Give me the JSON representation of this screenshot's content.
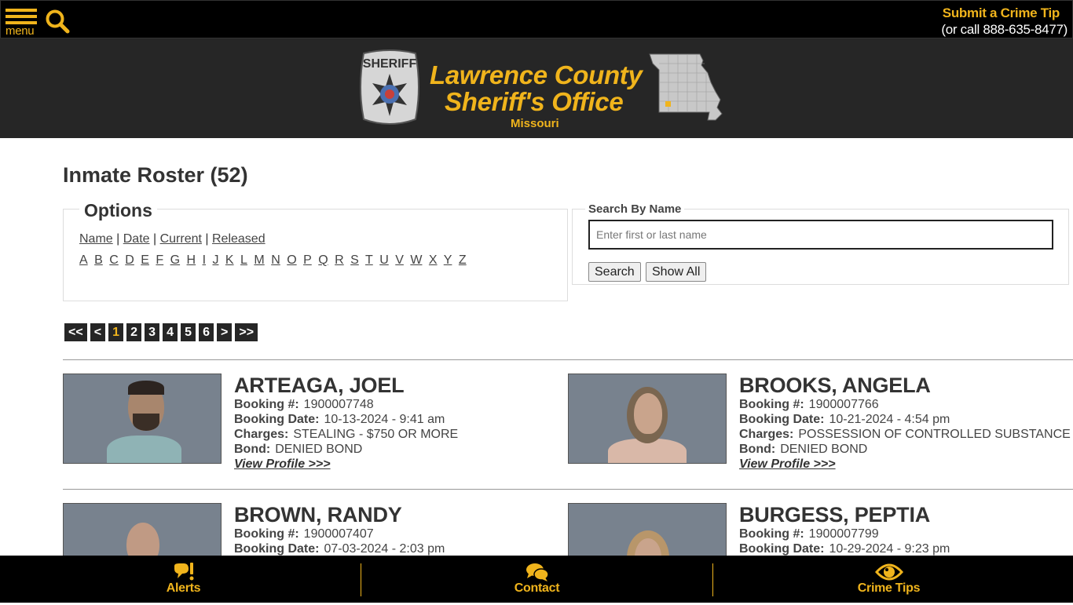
{
  "topbar": {
    "menu_label": "menu",
    "crime_tip_label": "Submit a Crime Tip",
    "crime_tip_phone": "(or call 888-635-8477)"
  },
  "banner": {
    "title_line1": "Lawrence County",
    "title_line2": "Sheriff's Office",
    "state": "Missouri",
    "badge_text": "SHERIFF"
  },
  "page": {
    "title": "Inmate Roster (52)"
  },
  "options": {
    "legend": "Options",
    "sort_links": [
      "Name",
      "Date",
      "Current",
      "Released"
    ],
    "letters": [
      "A",
      "B",
      "C",
      "D",
      "E",
      "F",
      "G",
      "H",
      "I",
      "J",
      "K",
      "L",
      "M",
      "N",
      "O",
      "P",
      "Q",
      "R",
      "S",
      "T",
      "U",
      "V",
      "W",
      "X",
      "Y",
      "Z"
    ]
  },
  "search": {
    "legend": "Search By Name",
    "placeholder": "Enter first or last name",
    "value": "",
    "search_button": "Search",
    "show_all_button": "Show All"
  },
  "pagination": {
    "first": "<<",
    "prev": "<",
    "pages": [
      "1",
      "2",
      "3",
      "4",
      "5",
      "6"
    ],
    "current": "1",
    "next": ">",
    "last": ">>"
  },
  "labels": {
    "booking_num": "Booking #:",
    "booking_date": "Booking Date:",
    "charges": "Charges:",
    "bond": "Bond:",
    "view_profile": "View Profile >>>"
  },
  "inmates": [
    {
      "name": "ARTEAGA, JOEL",
      "booking_num": "1900007748",
      "booking_date": "10-13-2024 - 9:41 am",
      "charges": "STEALING - $750 OR MORE",
      "bond": "DENIED BOND"
    },
    {
      "name": "BROOKS, ANGELA",
      "booking_num": "1900007766",
      "booking_date": "10-21-2024 - 4:54 pm",
      "charges": "POSSESSION OF CONTROLLED SUBSTANCE",
      "bond": "DENIED BOND"
    },
    {
      "name": "BROWN, RANDY",
      "booking_num": "1900007407",
      "booking_date": "07-03-2024 - 2:03 pm"
    },
    {
      "name": "BURGESS, PEPTIA",
      "booking_num": "1900007799",
      "booking_date": "10-29-2024 - 9:23 pm"
    }
  ],
  "footer": {
    "items": [
      {
        "label": "Alerts",
        "icon": "alert-bubble-icon"
      },
      {
        "label": "Contact",
        "icon": "chat-bubbles-icon"
      },
      {
        "label": "Crime Tips",
        "icon": "eye-icon"
      }
    ]
  },
  "colors": {
    "accent": "#f0b41c",
    "topbar_bg": "#000000",
    "banner_bg": "#262626"
  }
}
